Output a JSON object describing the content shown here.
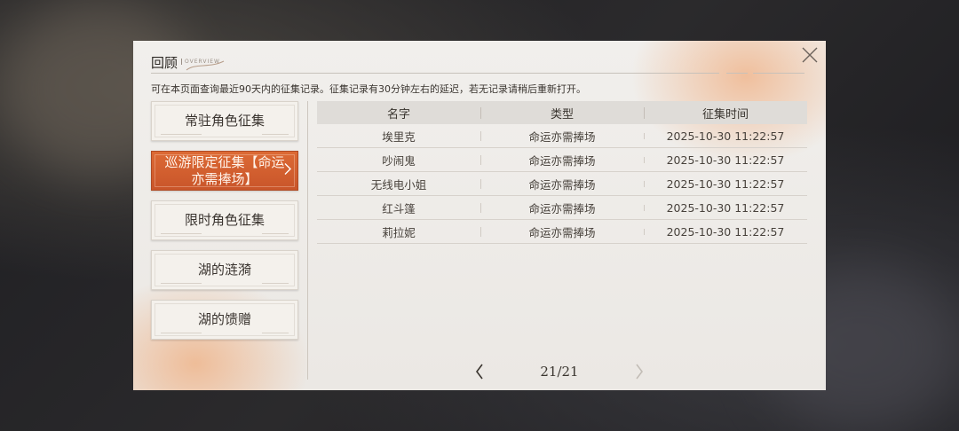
{
  "dialog": {
    "title": "回顾",
    "title_sub": "OVERVIEW",
    "notice": "可在本页面查询最近90天内的征集记录。征集记录有30分钟左右的延迟，若无记录请稍后重新打开。"
  },
  "categories": [
    {
      "label": "常驻角色征集",
      "active": false
    },
    {
      "label": "巡游限定征集【命运亦需捧场】",
      "active": true
    },
    {
      "label": "限时角色征集",
      "active": false
    },
    {
      "label": "湖的涟漪",
      "active": false
    },
    {
      "label": "湖的馈赠",
      "active": false
    }
  ],
  "table": {
    "headers": [
      "名字",
      "类型",
      "征集时间"
    ],
    "rows": [
      [
        "埃里克",
        "命运亦需捧场",
        "2025-10-30 11:22:57"
      ],
      [
        "吵闹鬼",
        "命运亦需捧场",
        "2025-10-30 11:22:57"
      ],
      [
        "无线电小姐",
        "命运亦需捧场",
        "2025-10-30 11:22:57"
      ],
      [
        "红斗篷",
        "命运亦需捧场",
        "2025-10-30 11:22:57"
      ],
      [
        "莉拉妮",
        "命运亦需捧场",
        "2025-10-30 11:22:57"
      ]
    ]
  },
  "pager": {
    "page": "21/21"
  },
  "icons": {
    "close": "close-icon",
    "prev": "chevron-left-icon",
    "next": "chevron-right-icon"
  },
  "colors": {
    "accent": "#d4602f",
    "panel_bg": "#efece8",
    "text": "#3a352f"
  }
}
